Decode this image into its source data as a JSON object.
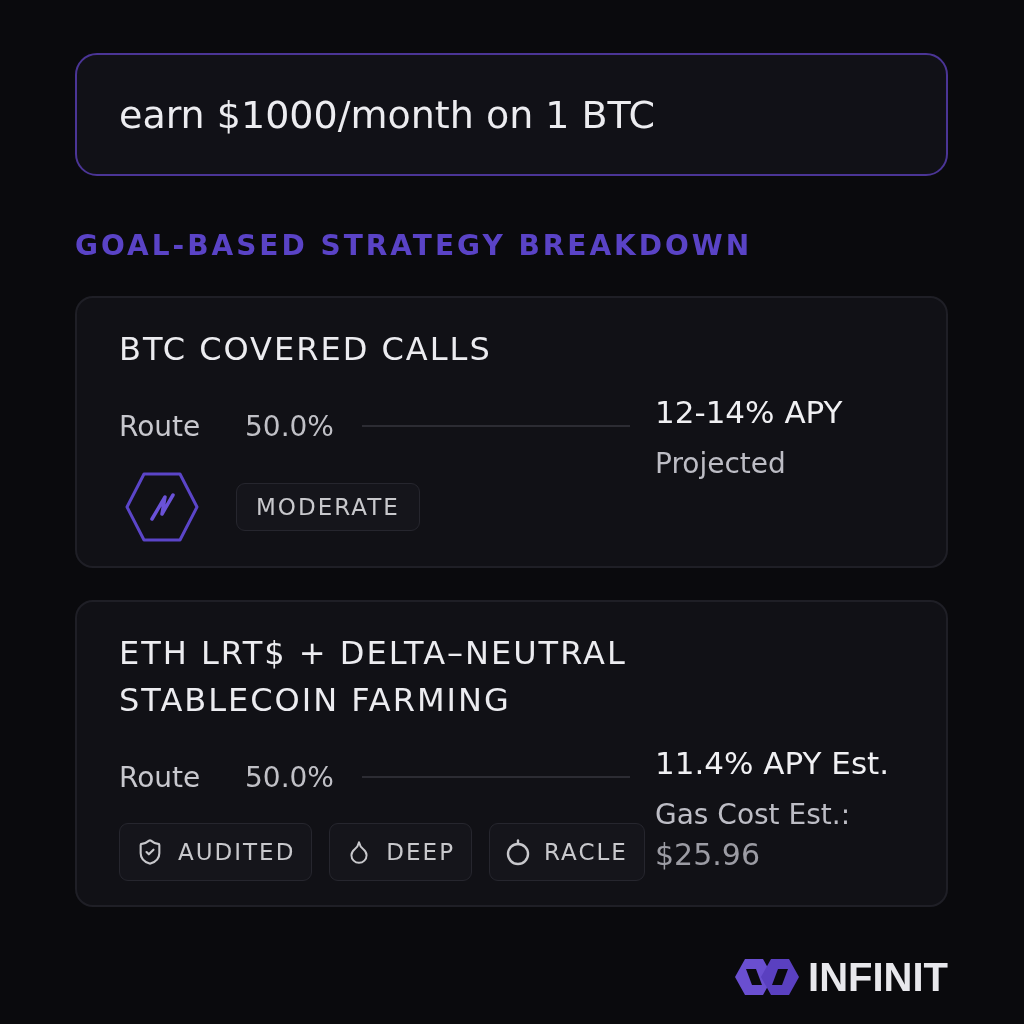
{
  "query_field": {
    "value": "earn $1000/month on 1 BTC"
  },
  "section_heading": "GOAL-BASED STRATEGY BREAKDOWN",
  "strategies": [
    {
      "title": "BTC COVERED CALLS",
      "route_label": "Route",
      "route_share": "50.0%",
      "apy": "12-14% APY",
      "apy_note": "Projected",
      "tags": [
        {
          "kind": "hexagon"
        },
        {
          "kind": "plain",
          "label": "MODERATE"
        }
      ]
    },
    {
      "title": "ETH LRT$ + DELTA–NEUTRAL STABLECOIN FARMING",
      "route_label": "Route",
      "route_share": "50.0%",
      "apy": "11.4% APY Est.",
      "gas_cost": {
        "label": "Gas Cost Est.:",
        "value": "$25.96"
      },
      "tags": [
        {
          "kind": "shield",
          "label": "AUDITED"
        },
        {
          "kind": "drop",
          "label": "DEEP"
        },
        {
          "kind": "ring",
          "label": "RACLE"
        }
      ]
    }
  ],
  "brand": {
    "name": "INFINIT"
  }
}
